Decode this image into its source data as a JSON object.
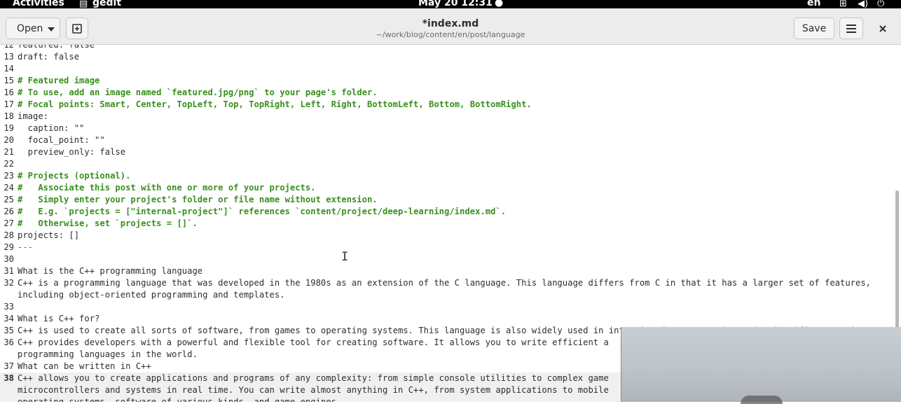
{
  "topbar": {
    "activities": "Activities",
    "app_name": "gedit",
    "clock": "May 20  12:31",
    "dot": "●",
    "lang": "en",
    "icons": [
      "app-icon",
      "network-icon",
      "volume-icon",
      "power-icon"
    ]
  },
  "header": {
    "open_label": "Open",
    "title": "*index.md",
    "subtitle": "~/work/blog/content/en/post/language",
    "save_label": "Save"
  },
  "editor": {
    "current_line": "38",
    "lines": [
      {
        "n": "12",
        "t": "featured: false",
        "k": ""
      },
      {
        "n": "13",
        "t": "draft: false",
        "k": ""
      },
      {
        "n": "14",
        "t": "",
        "k": ""
      },
      {
        "n": "15",
        "t": "# Featured image",
        "k": "comment"
      },
      {
        "n": "16",
        "t": "# To use, add an image named `featured.jpg/png` to your page's folder.",
        "k": "comment"
      },
      {
        "n": "17",
        "t": "# Focal points: Smart, Center, TopLeft, Top, TopRight, Left, Right, BottomLeft, Bottom, BottomRight.",
        "k": "comment"
      },
      {
        "n": "18",
        "t": "image:",
        "k": ""
      },
      {
        "n": "19",
        "t": "  caption: \"\"",
        "k": ""
      },
      {
        "n": "20",
        "t": "  focal_point: \"\"",
        "k": ""
      },
      {
        "n": "21",
        "t": "  preview_only: false",
        "k": ""
      },
      {
        "n": "22",
        "t": "",
        "k": ""
      },
      {
        "n": "23",
        "t": "# Projects (optional).",
        "k": "comment"
      },
      {
        "n": "24",
        "t": "#   Associate this post with one or more of your projects.",
        "k": "comment"
      },
      {
        "n": "25",
        "t": "#   Simply enter your project's folder or file name without extension.",
        "k": "comment"
      },
      {
        "n": "26",
        "t": "#   E.g. `projects = [\"internal-project\"]` references `content/project/deep-learning/index.md`.",
        "k": "comment"
      },
      {
        "n": "27",
        "t": "#   Otherwise, set `projects = []`.",
        "k": "comment"
      },
      {
        "n": "28",
        "t": "projects: []",
        "k": ""
      },
      {
        "n": "29",
        "t": "---",
        "k": "hr"
      },
      {
        "n": "30",
        "t": "",
        "k": ""
      },
      {
        "n": "31",
        "t": "What is the C++ programming language",
        "k": ""
      },
      {
        "n": "32",
        "t": "C++ is a programming language that was developed in the 1980s as an extension of the C language. This language differs from C in that it has a larger set of features,",
        "k": ""
      },
      {
        "n": "",
        "t": "including object-oriented programming and templates.",
        "k": ""
      },
      {
        "n": "33",
        "t": "",
        "k": ""
      },
      {
        "n": "34",
        "t": "What is C++ for?",
        "k": ""
      },
      {
        "n": "35",
        "t": "C++ is used to create all sorts of software, from games to operating systems. This language is also widely used in intensive data processing and scientific computing.",
        "k": ""
      },
      {
        "n": "36",
        "t": "C++ provides developers with a powerful and flexible tool for creating software. It allows you to write efficient a",
        "k": ""
      },
      {
        "n": "",
        "t": "programming languages in the world.",
        "k": ""
      },
      {
        "n": "37",
        "t": "What can be written in C++",
        "k": ""
      },
      {
        "n": "38",
        "t": "C++ allows you to create applications and programs of any complexity: from simple console utilities to complex game",
        "k": ""
      },
      {
        "n": "",
        "t": "microcontrollers and systems in real time. You can write almost anything in C++, from system applications to mobile",
        "k": ""
      },
      {
        "n": "",
        "t": "operating systems, software of various kinds, and game engines.",
        "k": ""
      }
    ]
  }
}
